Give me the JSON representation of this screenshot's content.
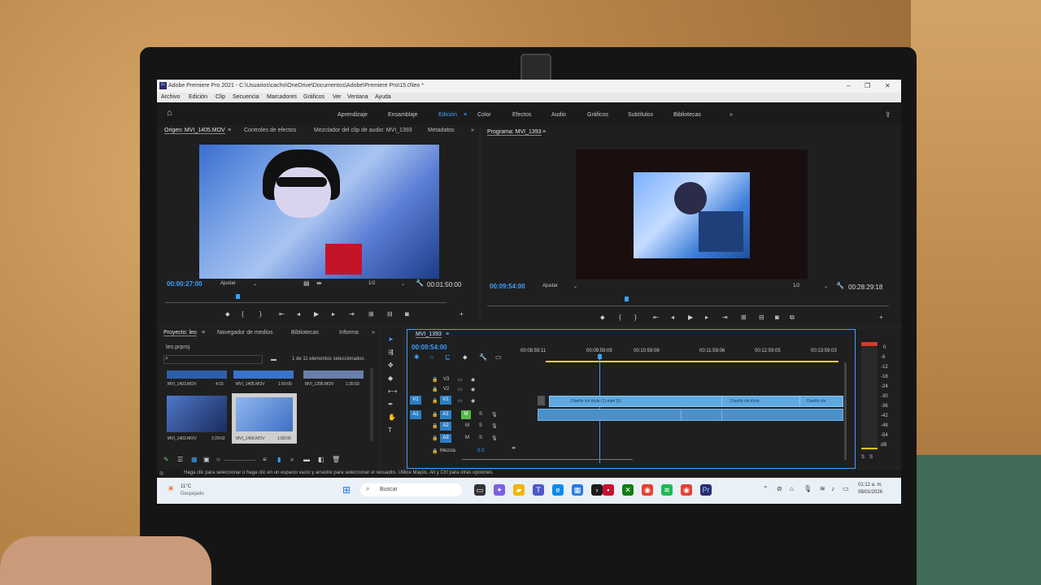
{
  "window": {
    "title": "Adobe Premiere Pro 2021 - C:\\Usuarios\\cacho\\OneDrive\\Documentos\\Adobe\\Premiere Pro\\15.0\\leo *",
    "controls": [
      "–",
      "❐",
      "✕"
    ]
  },
  "menu": [
    "Archivo",
    "Edición",
    "Clip",
    "Secuencia",
    "Marcadores",
    "Gráficos",
    "Ver",
    "Ventana",
    "Ayuda"
  ],
  "workspaces": {
    "tabs": [
      "Aprendizaje",
      "Ensamblaje",
      "Edición",
      "Color",
      "Efectos",
      "Audio",
      "Gráficos",
      "Subtítulos",
      "Bibliotecas"
    ],
    "active": "Edición",
    "more": "»"
  },
  "source_panel": {
    "tabs": [
      "Origen: MVI_1405.MOV",
      "Controles de efectos",
      "Mezclador del clip de audio: MVI_1393",
      "Metadatos"
    ],
    "timecode": "00:00:27:00",
    "fit": "Ajustar",
    "resolution": "1/2",
    "duration": "00:01:50:00"
  },
  "program_panel": {
    "title": "Programa: MVI_1393",
    "timecode": "00:09:54:00",
    "fit": "Ajustar",
    "resolution": "1/2",
    "duration": "00:28:29:18"
  },
  "project_panel": {
    "tabs": [
      "Proyecto: leo",
      "Navegador de medios",
      "Bibliotecas",
      "Informa"
    ],
    "file": "leo.prproj",
    "selection_info": "1 de 11 elementos seleccionados",
    "items": [
      {
        "name": "MVI_1403.MOV",
        "duration": "4:15"
      },
      {
        "name": "MVI_1405.MOV",
        "duration": "1:50:00"
      },
      {
        "name": "MVI_1395.MOV",
        "duration": "1:35:03"
      },
      {
        "name": "MVI_1402.MOV",
        "duration": "2:29:02"
      },
      {
        "name": "MVI_1406.MOV",
        "duration": "1:58:00"
      }
    ]
  },
  "timeline": {
    "sequence": "MVI_1393",
    "timecode": "00:09:54:00",
    "ruler": [
      "00:08:59:11",
      "00:09:59:09",
      "00:10:59:08",
      "00:11:59:06",
      "00:12:59:05",
      "00:13:59:03"
    ],
    "video_tracks": [
      "V3",
      "V2",
      "V1"
    ],
    "audio_tracks": [
      "A1",
      "A2",
      "A3"
    ],
    "mix_label": "Mezcla",
    "mix_value": "0.0",
    "clips": [
      "Diseño sin título (1).mp4 [V]",
      "Diseño sin título",
      "Diseño sin"
    ]
  },
  "meter": {
    "scale": [
      "0",
      "-6",
      "-12",
      "-18",
      "-24",
      "-30",
      "-36",
      "-42",
      "-48",
      "-54",
      "dB"
    ],
    "solo": [
      "S",
      "S"
    ]
  },
  "status": "Haga clic para seleccionar o haga clic en un espacio vacío y arrastre para seleccionar el recuadro. Utilice Mayús, Alt y Ctrl para otras opciones.",
  "taskbar": {
    "weather_temp": "11°C",
    "weather_desc": "Despejado",
    "search": "Buscar",
    "time": "01:12 a. m.",
    "date": "08/01/2026"
  }
}
